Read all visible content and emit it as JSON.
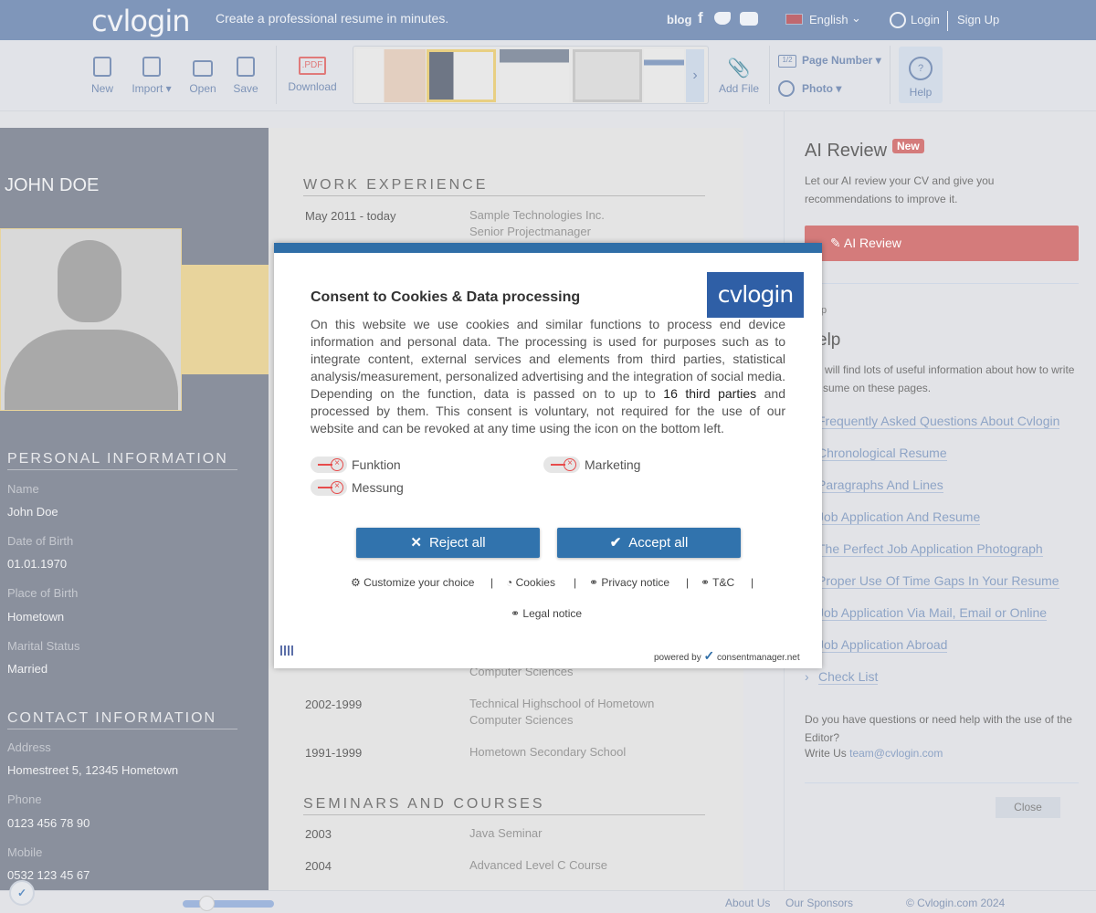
{
  "header": {
    "logo": "cvlogin",
    "tagline": "Create a professional resume in minutes.",
    "blog": "blog",
    "language": "English",
    "login": "Login",
    "signup": "Sign Up"
  },
  "toolbar": {
    "new": "New",
    "import": "Import ▾",
    "open": "Open",
    "save": "Save",
    "pdf_badge": ".PDF",
    "download": "Download",
    "add_file": "Add File",
    "page_number": "Page Number ▾",
    "page_badge": "1/2",
    "photo": "Photo ▾",
    "help": "Help"
  },
  "resume": {
    "name": "JOHN DOE",
    "personal_heading": "PERSONAL INFORMATION",
    "personal": [
      {
        "label": "Name",
        "value": "John Doe"
      },
      {
        "label": "Date of Birth",
        "value": "01.01.1970"
      },
      {
        "label": "Place of Birth",
        "value": "Hometown"
      },
      {
        "label": "Marital Status",
        "value": "Married"
      }
    ],
    "contact_heading": "CONTACT INFORMATION",
    "contact": [
      {
        "label": "Address",
        "value": "Homestreet 5, 12345 Hometown"
      },
      {
        "label": "Phone",
        "value": "0123 456 78 90"
      },
      {
        "label": "Mobile",
        "value": "0532 123 45 67"
      }
    ],
    "work_heading": "WORK EXPERIENCE",
    "work": [
      {
        "years": "May 2011 - today",
        "l1": "Sample Technologies Inc.",
        "l2": "Senior Projectmanager"
      }
    ],
    "edu_partial": "Computer Sciences",
    "edu": [
      {
        "years": "2002-1999",
        "l1": "Technical Highschool of Hometown",
        "l2": "Computer Sciences"
      },
      {
        "years": "1991-1999",
        "l1": "Hometown Secondary School",
        "l2": ""
      }
    ],
    "seminars_heading": "SEMINARS AND COURSES",
    "seminars": [
      {
        "years": "2003",
        "l1": "Java Seminar"
      },
      {
        "years": "2004",
        "l1": "Advanced Level C Course"
      }
    ]
  },
  "right_panel": {
    "ai_title": "AI Review",
    "new_badge": "New",
    "ai_desc": "Let our AI review your CV and give you recommendations to improve it.",
    "ai_button": "AI Review",
    "help_small": "p",
    "help_title": "elp",
    "help_desc_1": "will find lots of useful information about how to write",
    "help_desc_2": "sume on these pages.",
    "links": [
      "Frequently Asked Questions About Cvlogin",
      "Chronological Resume",
      "Paragraphs And Lines",
      "Job Application And Resume",
      "The Perfect Job Application Photograph",
      "Proper Use Of Time Gaps In Your Resume",
      "Job Application Via Mail, Email or Online",
      "Job Application Abroad",
      "Check List"
    ],
    "question": "Do you have questions or need help with the use of the Editor?",
    "write_us": "Write Us",
    "email": "team@cvlogin.com",
    "close": "Close"
  },
  "footer": {
    "about": "About Us",
    "sponsors": "Our Sponsors",
    "copyright": "© Cvlogin.com 2024",
    "zoom_level": 0.15
  },
  "consent": {
    "title": "Consent to Cookies & Data processing",
    "logo": "cvlogin",
    "text_1": "On this website we use cookies and similar functions to process end device information and personal data. The processing is used for purposes such as to integrate content, external services and elements from third parties, statistical analysis/measurement, personalized advertising and the integration of social media. Depending on the function, data is passed on to up to ",
    "third_parties": "16 third parties",
    "text_2": " and processed by them. This consent is voluntary, not required for the use of our website and can be revoked at any time using the icon on the bottom left.",
    "toggles": [
      {
        "label": "Funktion",
        "on": false
      },
      {
        "label": "Marketing",
        "on": false
      },
      {
        "label": "Messung",
        "on": false
      }
    ],
    "reject": "Reject all",
    "accept": "Accept all",
    "customize": "Customize your choice",
    "cookies": "Cookies",
    "privacy": "Privacy notice",
    "tc": "T&C",
    "legal": "Legal notice",
    "powered_by": "powered by",
    "provider": "consentmanager.net"
  },
  "colors": {
    "header": "#7f96ba",
    "consent_blue": "#3173ad",
    "ai_button": "#d47b7b",
    "sidebar": "#8a909d"
  }
}
